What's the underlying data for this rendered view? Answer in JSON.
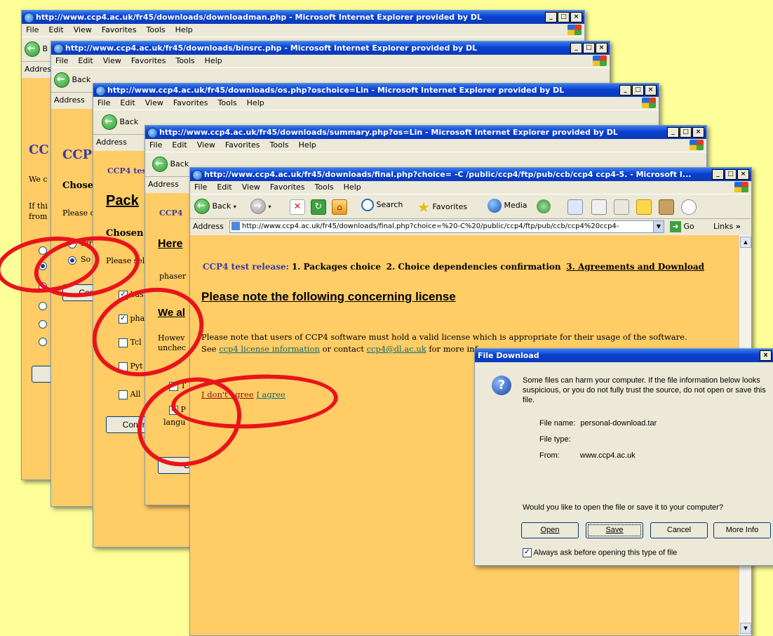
{
  "window1": {
    "title": "http://www.ccp4.ac.uk/fr45/downloads/downloadman.php - Microsoft Internet Explorer provided by DL",
    "menu": [
      "File",
      "Edit",
      "View",
      "Favorites",
      "Tools",
      "Help"
    ],
    "back_label": "B",
    "address_label": "Addres",
    "content_heading": "CC",
    "content_line1": "We c",
    "content_line2": "If thi",
    "content_line3": "from",
    "button": "Co"
  },
  "window2": {
    "title": "http://www.ccp4.ac.uk/fr45/downloads/binsrc.php - Microsoft Internet Explorer provided by DL",
    "menu": [
      "File",
      "Edit",
      "View",
      "Favorites",
      "Tools",
      "Help"
    ],
    "back_label": "Back",
    "address_label": "Address",
    "content_heading": "CCP",
    "chosen": "Chose",
    "please": "Please c",
    "radio1": "Bir",
    "radio2": "So",
    "button": "Cont"
  },
  "window3": {
    "title": "http://www.ccp4.ac.uk/fr45/downloads/os.php?oschoice=Lin - Microsoft Internet Explorer provided by DL",
    "menu": [
      "File",
      "Edit",
      "View",
      "Favorites",
      "Tools",
      "Help"
    ],
    "back_label": "Back",
    "address_label": "Address",
    "ccp4test": "CCP4 tes",
    "heading": "Pack",
    "chosen": "Chosen",
    "please": "Please sel",
    "checks": [
      "bas",
      "pha",
      "Tcl",
      "Pyt",
      "All"
    ],
    "button": "Contin"
  },
  "window4": {
    "title": "http://www.ccp4.ac.uk/fr45/downloads/summary.php?os=Lin - Microsoft Internet Explorer provided by DL",
    "menu": [
      "File",
      "Edit",
      "View",
      "Favorites",
      "Tools",
      "Help"
    ],
    "back_label": "Back",
    "address_label": "Address",
    "ccp4": "CCP4",
    "here": "Here",
    "phaser": "phaser",
    "we_al": "We al",
    "however": "Howev",
    "unchec": "unchec",
    "check1": "T",
    "check2": "P",
    "langu": "langu",
    "button": "C"
  },
  "window5": {
    "title": "http://www.ccp4.ac.uk/fr45/downloads/final.php?choice= -C /public/ccp4/ftp/pub/ccb/ccp4 ccp4-5. - Microsoft I...",
    "menu": [
      "File",
      "Edit",
      "View",
      "Favorites",
      "Tools",
      "Help"
    ],
    "toolbar": {
      "back": "Back",
      "search": "Search",
      "favorites": "Favorites",
      "media": "Media"
    },
    "address_label": "Address",
    "address_value": "http://www.ccp4.ac.uk/fr45/downloads/final.php?choice=%20-C%20/public/ccp4/ftp/pub/ccb/ccp4%20ccp4-",
    "go": "Go",
    "links": "Links",
    "links_chevron": "»",
    "release_label": "CCP4 test release:",
    "step1": "1. Packages choice",
    "step2": "2. Choice dependencies confirmation",
    "step3": "3. Agreements and Download",
    "heading": "Please note the following concerning license",
    "para1": "Please note that users of CCP4 software must hold a valid license which is appropriate for their usage of the software.",
    "para2_pre": "See",
    "para2_link1": "ccp4 license information",
    "para2_mid": "or contact",
    "para2_link2": "ccp4@dl.ac.uk",
    "para2_post": "for more inf",
    "disagree": "I don't agree",
    "agree": "I agree"
  },
  "dialog": {
    "title": "File Download",
    "close": "x",
    "warning": "Some files can harm your computer. If the file information below looks suspicious, or you do not fully trust the source, do not open or save this file.",
    "file_name_label": "File name:",
    "file_name": "personal-download.tar",
    "file_type_label": "File type:",
    "from_label": "From:",
    "from": "www.ccp4.ac.uk",
    "question": "Would you like to open the file or save it to your computer?",
    "open": "Open",
    "save": "Save",
    "cancel": "Cancel",
    "more_info": "More Info",
    "always_ask": "Always ask before opening this type of file"
  },
  "colors": {
    "background": "#ffff99",
    "page": "#ffcc66",
    "highlight": "#e8141c",
    "title_blue": "#0a3fd0"
  }
}
